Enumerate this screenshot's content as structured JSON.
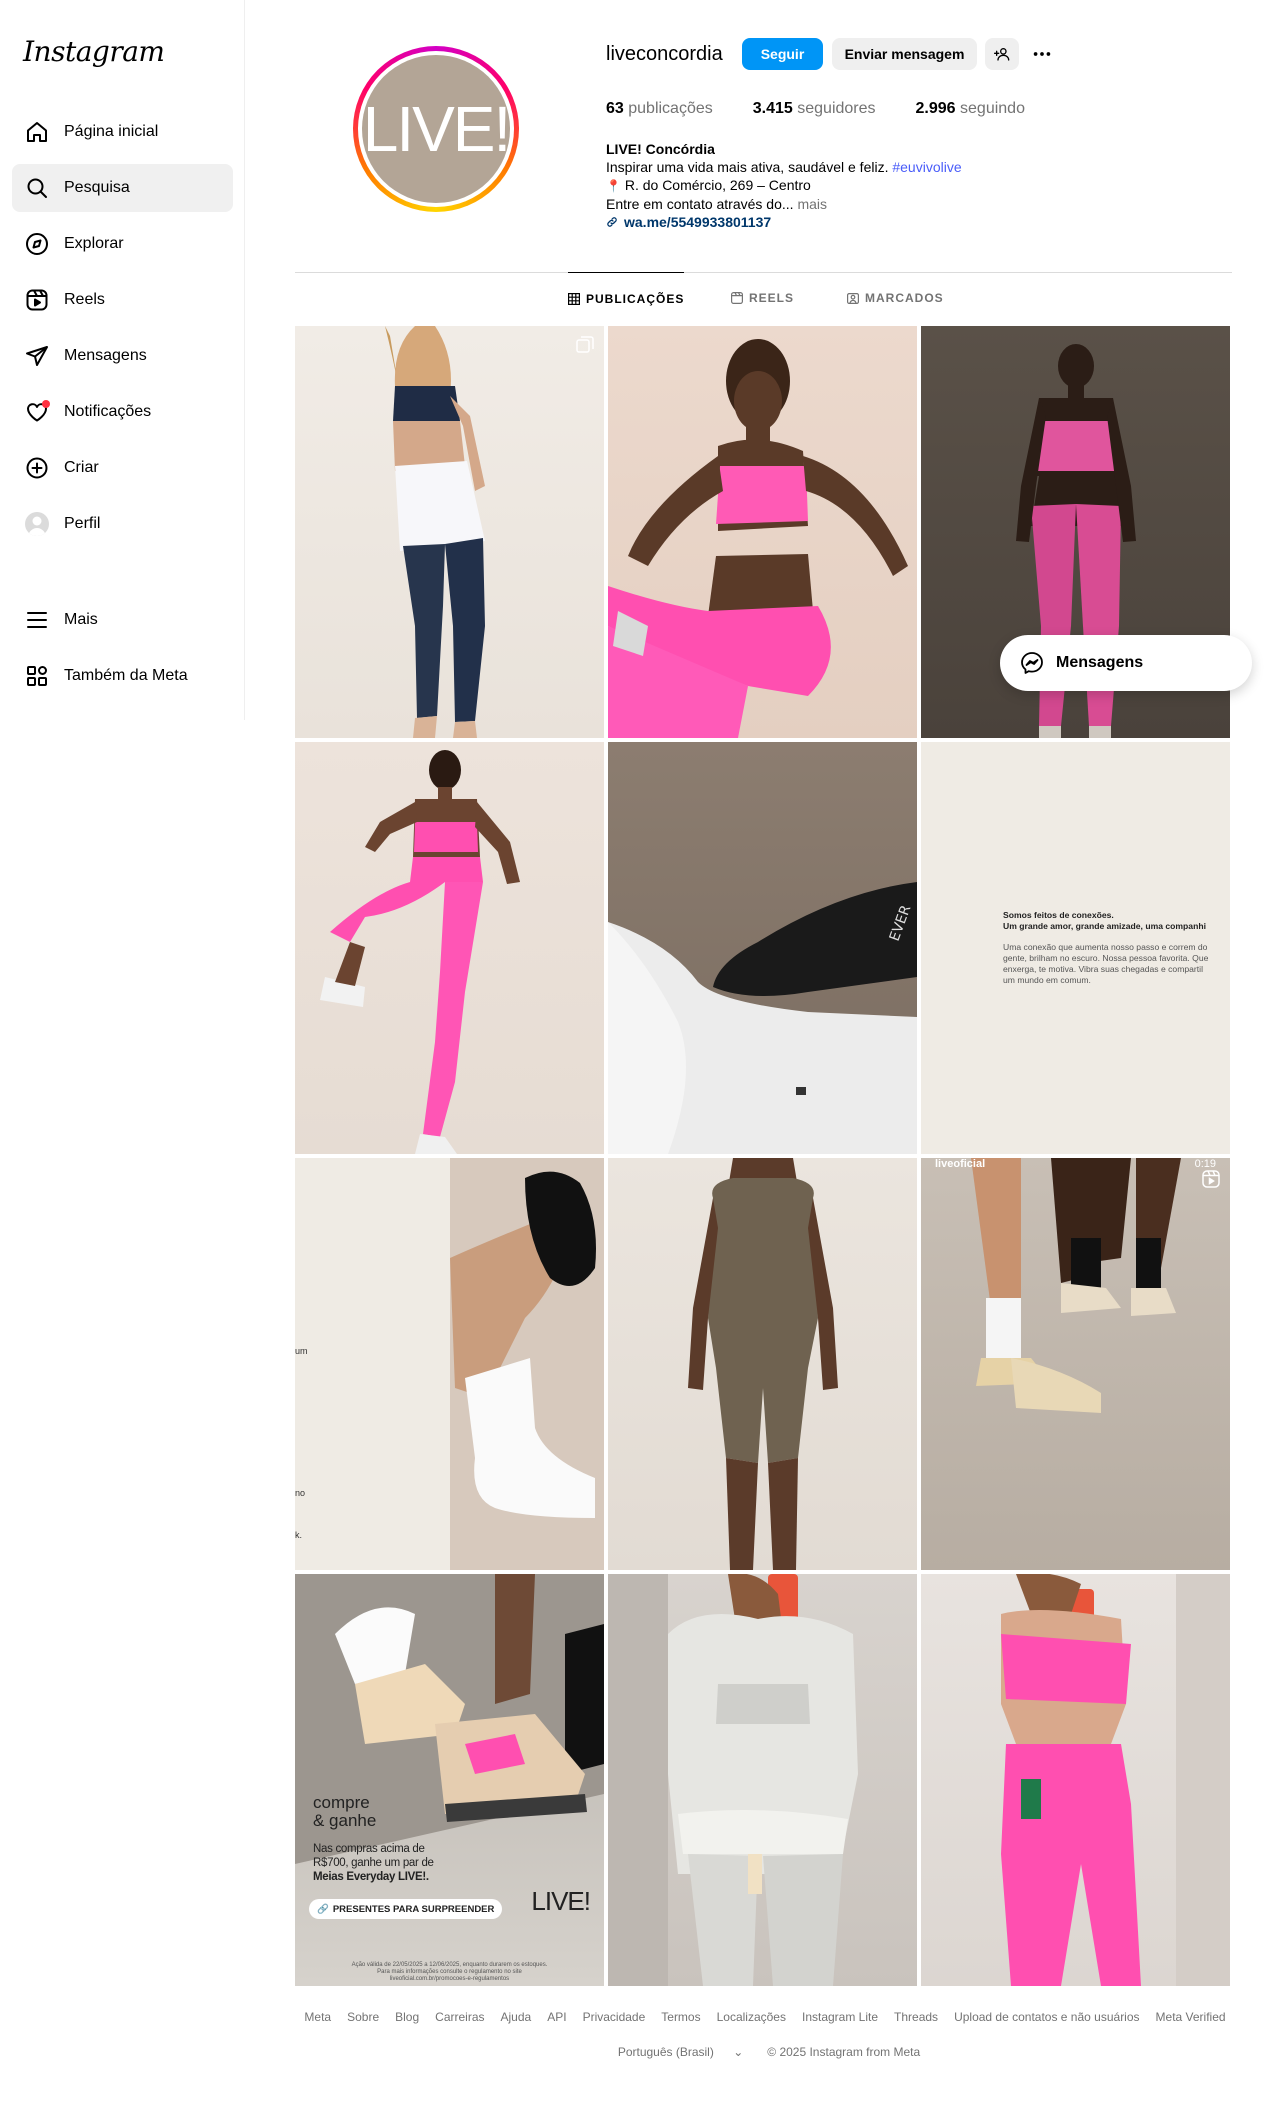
{
  "app": {
    "logo": "Instagram"
  },
  "sidebar": {
    "items": [
      {
        "label": "Página inicial",
        "icon": "home-icon"
      },
      {
        "label": "Pesquisa",
        "icon": "search-icon"
      },
      {
        "label": "Explorar",
        "icon": "compass-icon"
      },
      {
        "label": "Reels",
        "icon": "reels-icon"
      },
      {
        "label": "Mensagens",
        "icon": "messages-icon"
      },
      {
        "label": "Notificações",
        "icon": "heart-icon"
      },
      {
        "label": "Criar",
        "icon": "plus-square-icon"
      },
      {
        "label": "Perfil",
        "icon": "avatar"
      }
    ],
    "bottom": [
      {
        "label": "Mais",
        "icon": "menu-icon"
      },
      {
        "label": "Também da Meta",
        "icon": "meta-apps-icon"
      }
    ],
    "active_index": 1
  },
  "profile": {
    "avatar_text": "LIVE!",
    "username": "liveconcordia",
    "follow_label": "Seguir",
    "message_label": "Enviar mensagem",
    "stats": {
      "posts_count": "63",
      "posts_label": "publicações",
      "followers_count": "3.415",
      "followers_label": "seguidores",
      "following_count": "2.996",
      "following_label": "seguindo"
    },
    "bio": {
      "name": "LIVE! Concórdia",
      "line1": "Inspirar uma vida mais ativa, saudável e feliz.",
      "hashtag": "#euvivolive",
      "address_pin": "📍",
      "address": "R. do Comércio, 269 – Centro",
      "line3": "Entre em contato através do...",
      "more": "mais",
      "link": "wa.me/5549933801137"
    }
  },
  "tabs": [
    {
      "label": "PUBLICAÇÕES",
      "icon": "grid-icon",
      "active": true
    },
    {
      "label": "REELS",
      "icon": "reels-icon",
      "active": false
    },
    {
      "label": "MARCADOS",
      "icon": "tagged-icon",
      "active": false
    }
  ],
  "posts": {
    "p6_text1": "Somos feitos de conexões.",
    "p6_text2": "Um grande amor, grande amizade, uma companhi",
    "p6_text3": "Uma conexão que aumenta nosso passo e correm do",
    "p6_text4": "gente, brilham no escuro. Nossa pessoa favorita. Que",
    "p6_text5": "enxerga, te motiva. Vibra suas chegadas e compartil",
    "p6_text6": "um mundo em comum.",
    "p7_text1": "um",
    "p7_text2": "no",
    "p7_text3": "k.",
    "p9_user": "liveoficial",
    "p9_time": "0:19",
    "p10_title1": "compre",
    "p10_title2": "& ganhe",
    "p10_body1": "Nas compras acima de",
    "p10_body2": "R$700, ganhe um par de",
    "p10_body3": "Meias Everyday LIVE!.",
    "p10_cta": "PRESENTES PARA SURPREENDER",
    "p10_logo": "LIVE!",
    "p10_fine1": "Ação válida de 22/05/2025 a 12/06/2025, enquanto durarem os estoques.",
    "p10_fine2": "Para mais informações consulte o regulamento no site",
    "p10_fine3": "liveoficial.com.br/promocoes-e-regulamentos"
  },
  "messenger": {
    "label": "Mensagens"
  },
  "footer": {
    "links": [
      "Meta",
      "Sobre",
      "Blog",
      "Carreiras",
      "Ajuda",
      "API",
      "Privacidade",
      "Termos",
      "Localizações",
      "Instagram Lite",
      "Threads",
      "Upload de contatos e não usuários",
      "Meta Verified"
    ],
    "language": "Português (Brasil)",
    "copyright": "© 2025 Instagram from Meta"
  },
  "colors": {
    "accent": "#0095f6",
    "pink": "#ff4fb0",
    "avatar_bg": "#b3a596"
  }
}
